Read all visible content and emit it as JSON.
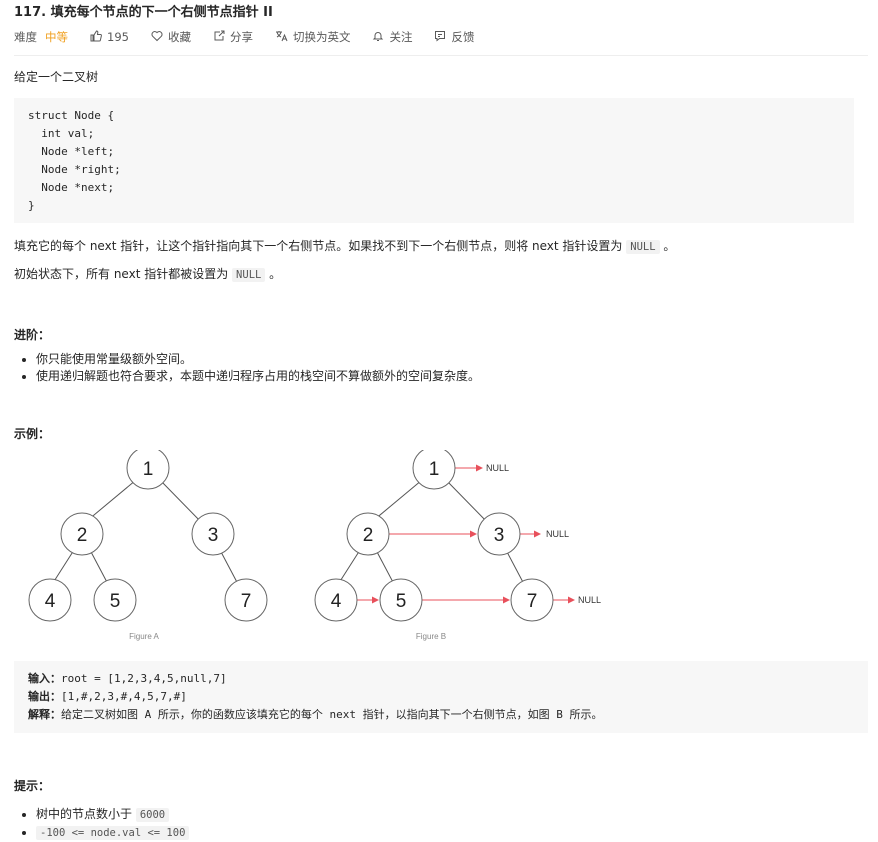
{
  "problem": {
    "title": "117. 填充每个节点的下一个右侧节点指针 II",
    "difficulty_label": "难度",
    "difficulty": "中等",
    "likes": "195",
    "actions": {
      "favorite": "收藏",
      "share": "分享",
      "switch_lang": "切换为英文",
      "follow": "关注",
      "feedback": "反馈"
    }
  },
  "content": {
    "intro": "给定一个二叉树",
    "code": "struct Node {\n  int val;\n  Node *left;\n  Node *right;\n  Node *next;\n}",
    "para1_a": "填充它的每个 next 指针，让这个指针指向其下一个右侧节点。如果找不到下一个右侧节点，则将 next 指针设置为",
    "para1_code": "NULL",
    "para1_b": "。",
    "para2_a": "初始状态下，所有 next 指针都被设置为",
    "para2_code": "NULL",
    "para2_b": "。",
    "advanced_heading": "进阶：",
    "advanced_items": [
      "你只能使用常量级额外空间。",
      "使用递归解题也符合要求，本题中递归程序占用的栈空间不算做额外的空间复杂度。"
    ],
    "example_heading": "示例：",
    "example": {
      "input_label": "输入：",
      "input_value": "root = [1,2,3,4,5,null,7]",
      "output_label": "输出：",
      "output_value": "[1,#,2,3,#,4,5,7,#]",
      "explain_label": "解释：",
      "explain_value": "给定二叉树如图 A 所示，你的函数应该填充它的每个 next 指针，以指向其下一个右侧节点，如图 B 所示。"
    },
    "tips_heading": "提示：",
    "tips": [
      {
        "text": "树中的节点数小于",
        "code": "6000"
      },
      {
        "code": "-100  <= node.val <= 100"
      }
    ]
  },
  "figure": {
    "caption_a": "Figure A",
    "caption_b": "Figure B",
    "node_labels": [
      "1",
      "2",
      "3",
      "4",
      "5",
      "7"
    ],
    "null_label": "NULL",
    "arrow_color": "#e8505b"
  }
}
